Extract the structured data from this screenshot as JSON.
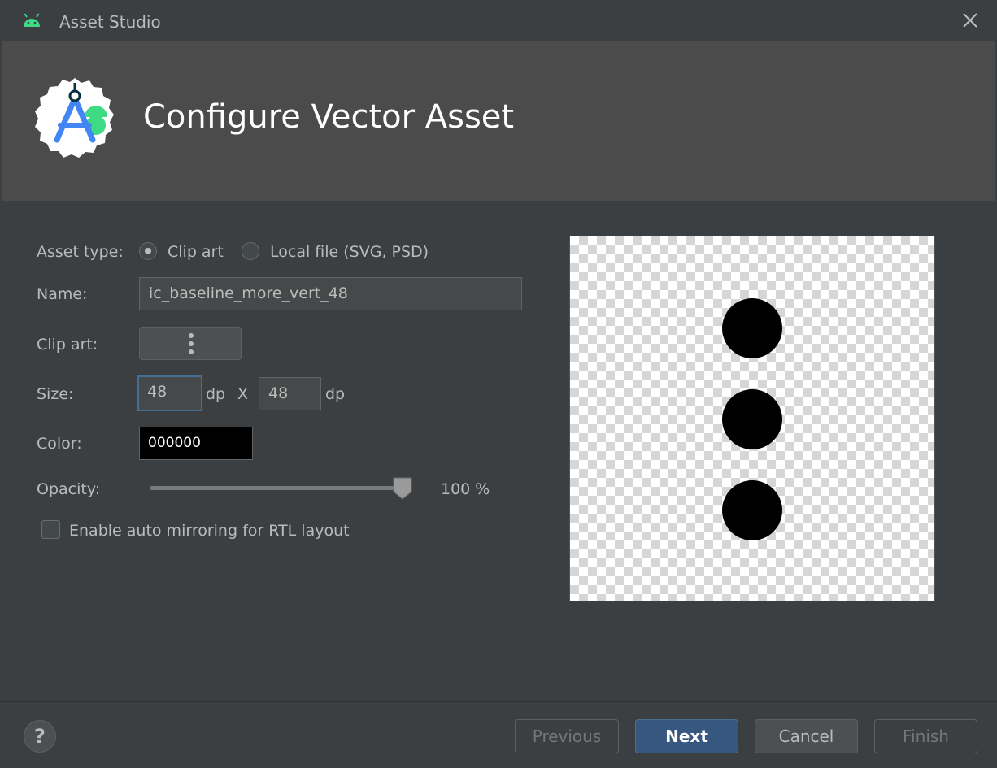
{
  "window": {
    "title": "Asset Studio",
    "android_icon": "android-head-icon",
    "close_icon": "close-icon"
  },
  "header": {
    "logo_icon": "android-studio-logo-icon",
    "heading": "Configure Vector Asset"
  },
  "form": {
    "asset_type": {
      "label": "Asset type:",
      "options": [
        {
          "label": "Clip art",
          "checked": true
        },
        {
          "label": "Local file (SVG, PSD)",
          "checked": false
        }
      ]
    },
    "name": {
      "label": "Name:",
      "value": "ic_baseline_more_vert_48"
    },
    "clip_art": {
      "label": "Clip art:",
      "icon": "more-vert-icon"
    },
    "size": {
      "label": "Size:",
      "width": "48",
      "height": "48",
      "unit": "dp",
      "separator": "X"
    },
    "color": {
      "label": "Color:",
      "value": "000000"
    },
    "opacity": {
      "label": "Opacity:",
      "value_text": "100 %",
      "value": 100
    },
    "rtl": {
      "label": "Enable auto mirroring for RTL layout",
      "checked": false
    }
  },
  "preview": {
    "icon": "more-vert-icon",
    "background": "checkerboard"
  },
  "footer": {
    "help_label": "?",
    "previous_label": "Previous",
    "next_label": "Next",
    "cancel_label": "Cancel",
    "finish_label": "Finish"
  },
  "colors": {
    "background": "#3c3f41",
    "header": "#4b4b4b",
    "accent": "#365880",
    "focus": "#466d94"
  }
}
